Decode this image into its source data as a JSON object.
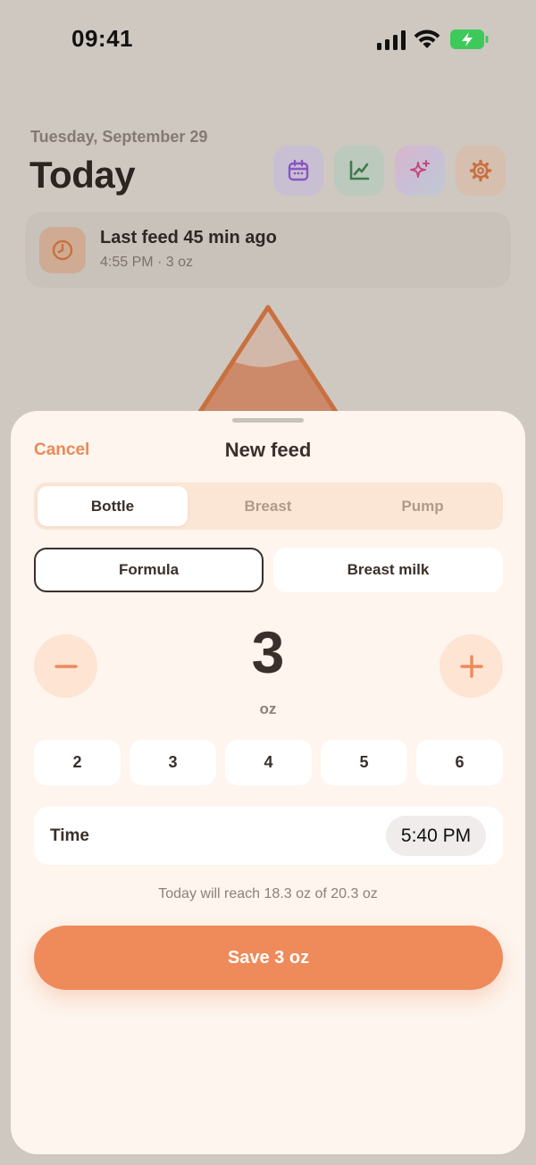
{
  "status_bar": {
    "time": "09:41"
  },
  "background": {
    "date": "Tuesday, September 29",
    "title": "Today",
    "icons": [
      "calendar-icon",
      "chart-icon",
      "sparkles-icon",
      "gear-icon"
    ],
    "last_feed": {
      "title": "Last feed 45 min ago",
      "subtitle": "4:55 PM · 3 oz"
    }
  },
  "sheet": {
    "cancel_label": "Cancel",
    "title": "New feed",
    "segments": [
      {
        "label": "Bottle",
        "selected": true
      },
      {
        "label": "Breast",
        "selected": false
      },
      {
        "label": "Pump",
        "selected": false
      }
    ],
    "milk_types": [
      {
        "label": "Formula",
        "selected": true
      },
      {
        "label": "Breast milk",
        "selected": false
      }
    ],
    "amount": {
      "value": "3",
      "unit": "oz"
    },
    "quick_amounts": [
      "2",
      "3",
      "4",
      "5",
      "6"
    ],
    "time": {
      "label": "Time",
      "value": "5:40 PM"
    },
    "summary": "Today will reach 18.3 oz of 20.3 oz",
    "save_label": "Save 3 oz"
  },
  "colors": {
    "accent": "#ef8a5a",
    "sheet_bg": "#fdf5ee",
    "text": "#3a2f2a",
    "battery": "#3ec95b"
  }
}
